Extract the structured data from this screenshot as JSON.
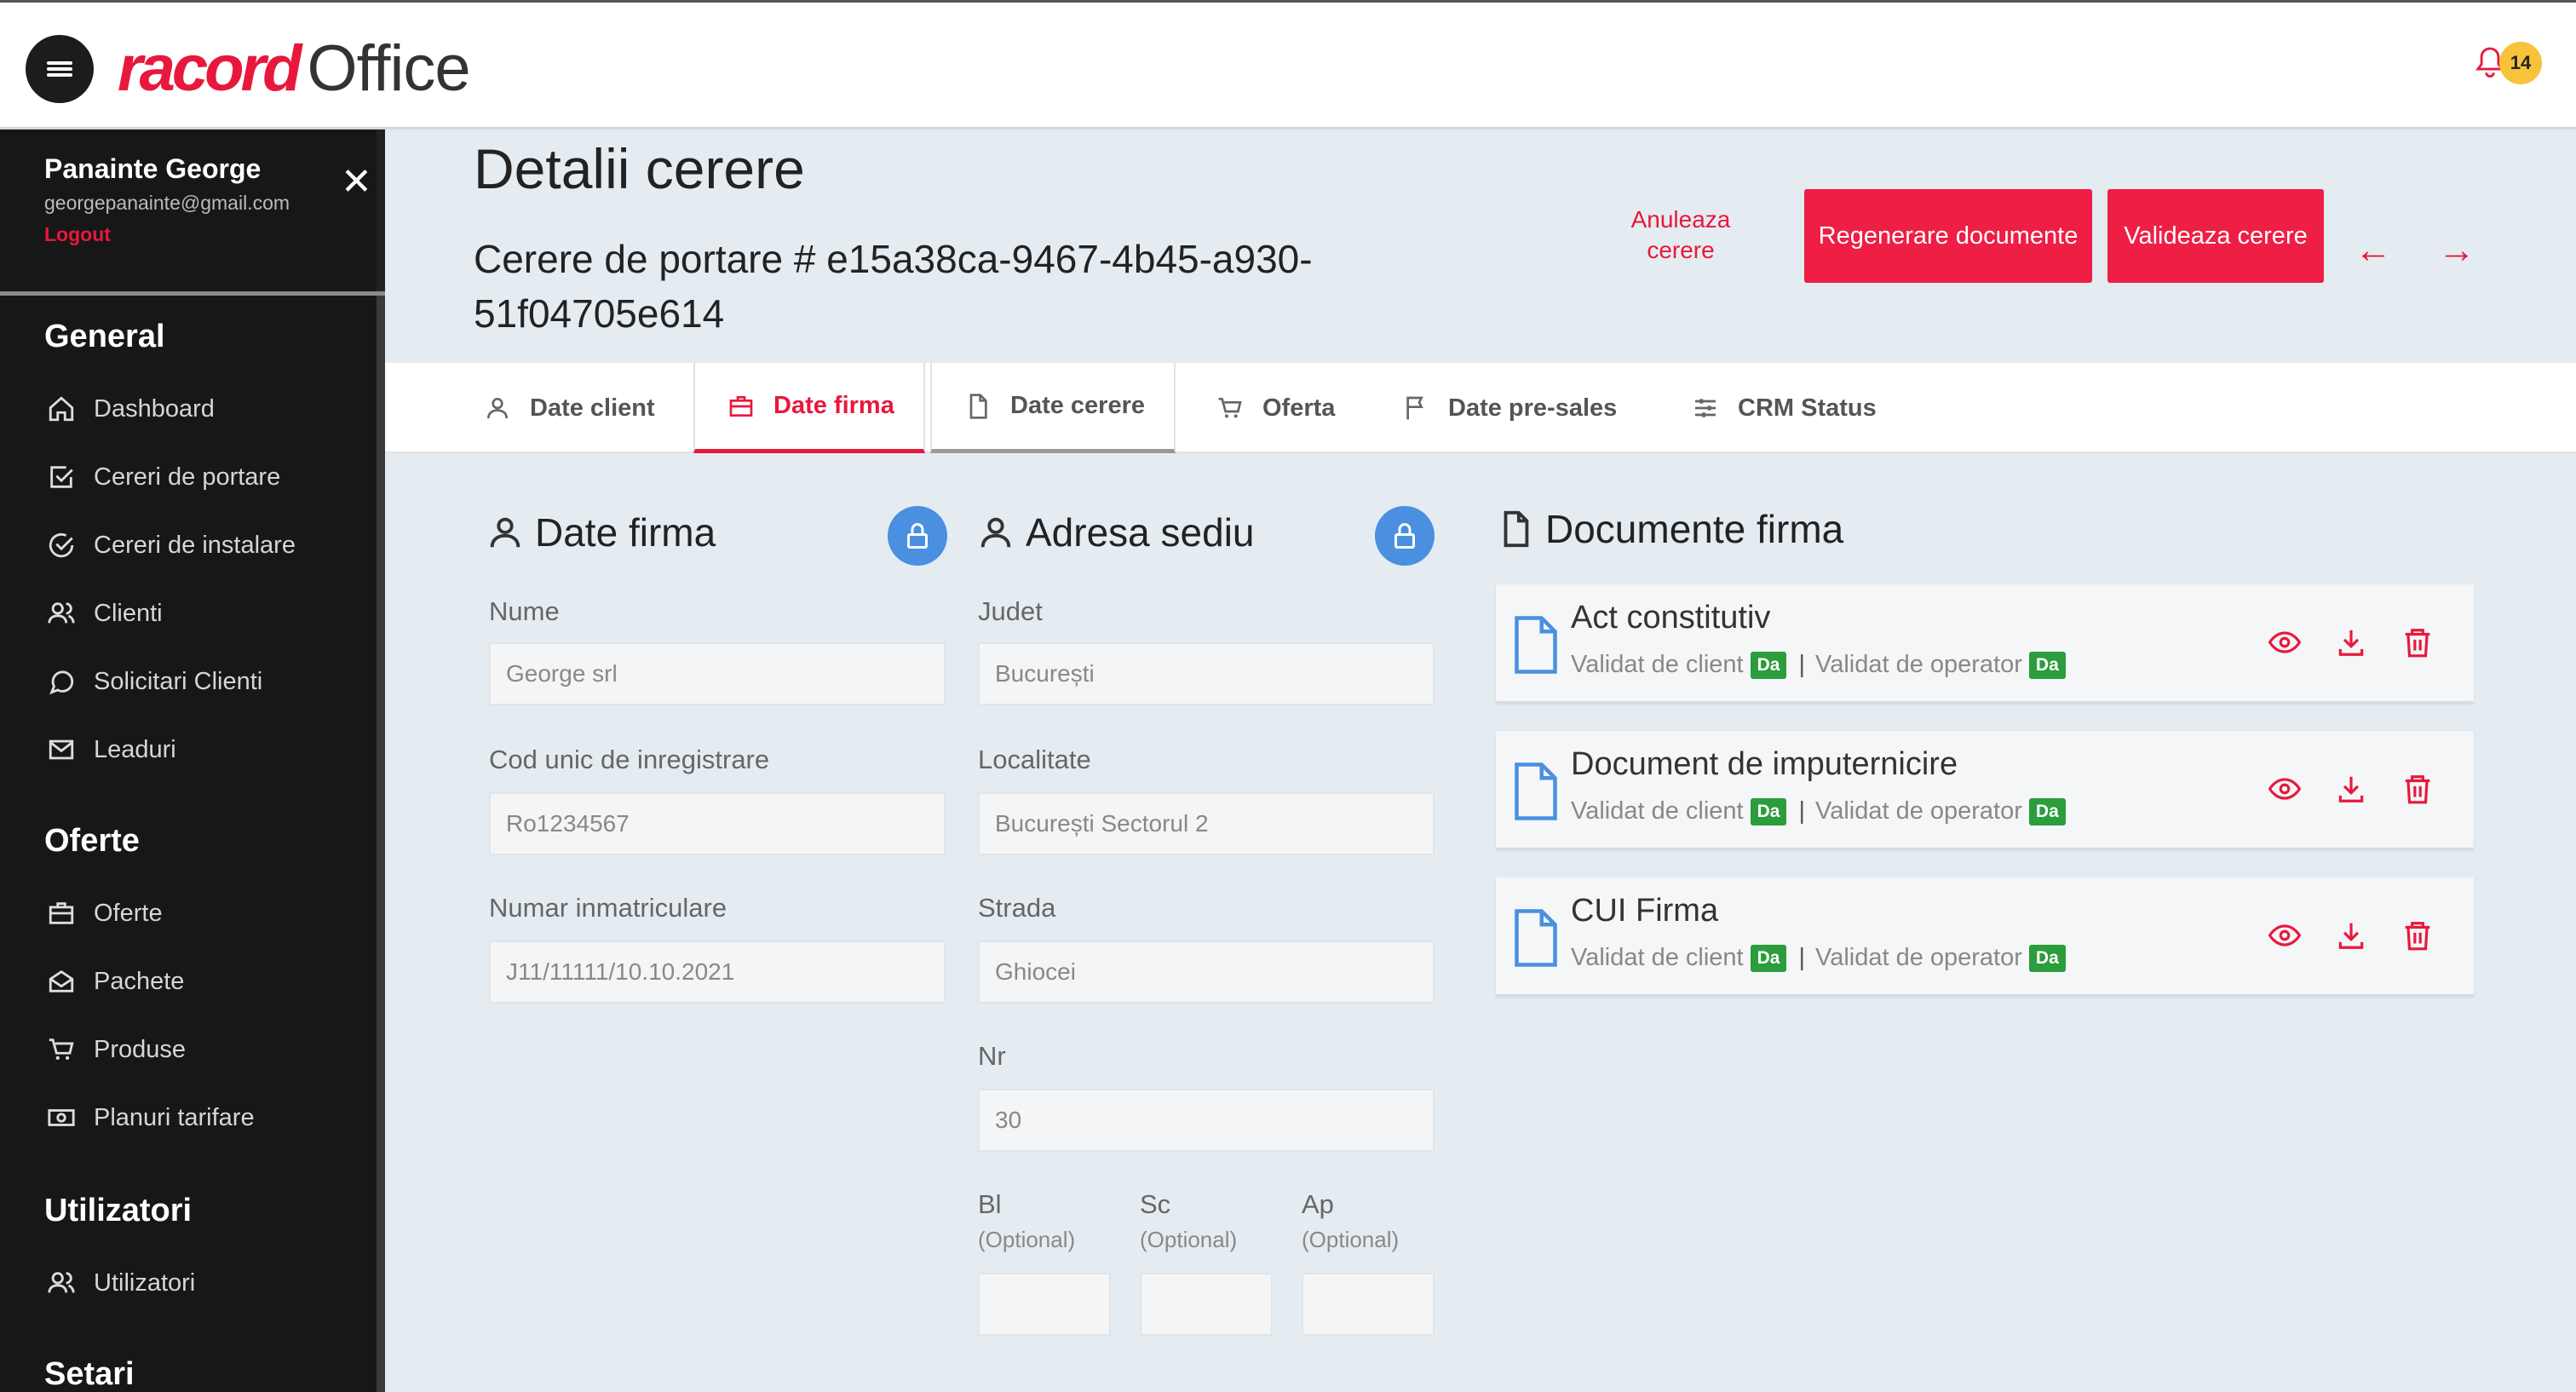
{
  "app": {
    "brand": "racord",
    "product": "Office",
    "notifications_count": "14"
  },
  "user": {
    "name": "Panainte George",
    "email": "georgepanainte@gmail.com",
    "logout": "Logout"
  },
  "sidebar": {
    "sections": [
      {
        "title": "General",
        "items": [
          {
            "label": "Dashboard",
            "icon": "home-icon"
          },
          {
            "label": "Cereri de portare",
            "icon": "check-square-icon"
          },
          {
            "label": "Cereri de instalare",
            "icon": "check-circle-icon"
          },
          {
            "label": "Clienti",
            "icon": "users-icon"
          },
          {
            "label": "Solicitari Clienti",
            "icon": "chat-icon"
          },
          {
            "label": "Leaduri",
            "icon": "mail-icon"
          }
        ]
      },
      {
        "title": "Oferte",
        "items": [
          {
            "label": "Oferte",
            "icon": "briefcase-icon"
          },
          {
            "label": "Pachete",
            "icon": "package-icon"
          },
          {
            "label": "Produse",
            "icon": "cart-icon"
          },
          {
            "label": "Planuri tarifare",
            "icon": "money-icon"
          }
        ]
      },
      {
        "title": "Utilizatori",
        "items": [
          {
            "label": "Utilizatori",
            "icon": "users-icon"
          }
        ]
      },
      {
        "title": "Setari",
        "items": []
      }
    ]
  },
  "header": {
    "title": "Detalii cerere",
    "subtitle": "Cerere de portare # e15a38ca-9467-4b45-a930-51f04705e614",
    "cancel": "Anuleaza cerere",
    "regenerate": "Regenerare documente",
    "validate": "Valideaza cerere"
  },
  "tabs": [
    {
      "label": "Date client",
      "icon": "user-icon"
    },
    {
      "label": "Date firma",
      "icon": "briefcase-icon",
      "active": true
    },
    {
      "label": "Date cerere",
      "icon": "file-icon"
    },
    {
      "label": "Oferta",
      "icon": "cart-icon"
    },
    {
      "label": "Date pre-sales",
      "icon": "flag-icon"
    },
    {
      "label": "CRM Status",
      "icon": "sliders-icon"
    }
  ],
  "firma": {
    "title": "Date firma",
    "fields": [
      {
        "label": "Nume",
        "value": "George srl"
      },
      {
        "label": "Cod unic de inregistrare",
        "value": "Ro1234567"
      },
      {
        "label": "Numar inmatriculare",
        "value": "J11/11111/10.10.2021"
      }
    ]
  },
  "sediu": {
    "title": "Adresa sediu",
    "fields": [
      {
        "label": "Judet",
        "value": "București"
      },
      {
        "label": "Localitate",
        "value": "București Sectorul 2"
      },
      {
        "label": "Strada",
        "value": "Ghiocei"
      },
      {
        "label": "Nr",
        "value": "30"
      }
    ],
    "optional": [
      {
        "label": "Bl",
        "hint": "(Optional)",
        "value": ""
      },
      {
        "label": "Sc",
        "hint": "(Optional)",
        "value": ""
      },
      {
        "label": "Ap",
        "hint": "(Optional)",
        "value": ""
      }
    ]
  },
  "documente": {
    "title": "Documente firma",
    "client_label": "Validat de client",
    "operator_label": "Validat de operator",
    "yes": "Da",
    "items": [
      {
        "name": "Act constitutiv",
        "client": "Da",
        "operator": "Da"
      },
      {
        "name": "Document de imputernicire",
        "client": "Da",
        "operator": "Da"
      },
      {
        "name": "CUI Firma",
        "client": "Da",
        "operator": "Da"
      }
    ]
  },
  "colors": {
    "accent": "#ee1e45",
    "lock": "#4a8fe0",
    "badge_ok": "#2b9d3c",
    "sidebar": "#171717"
  }
}
